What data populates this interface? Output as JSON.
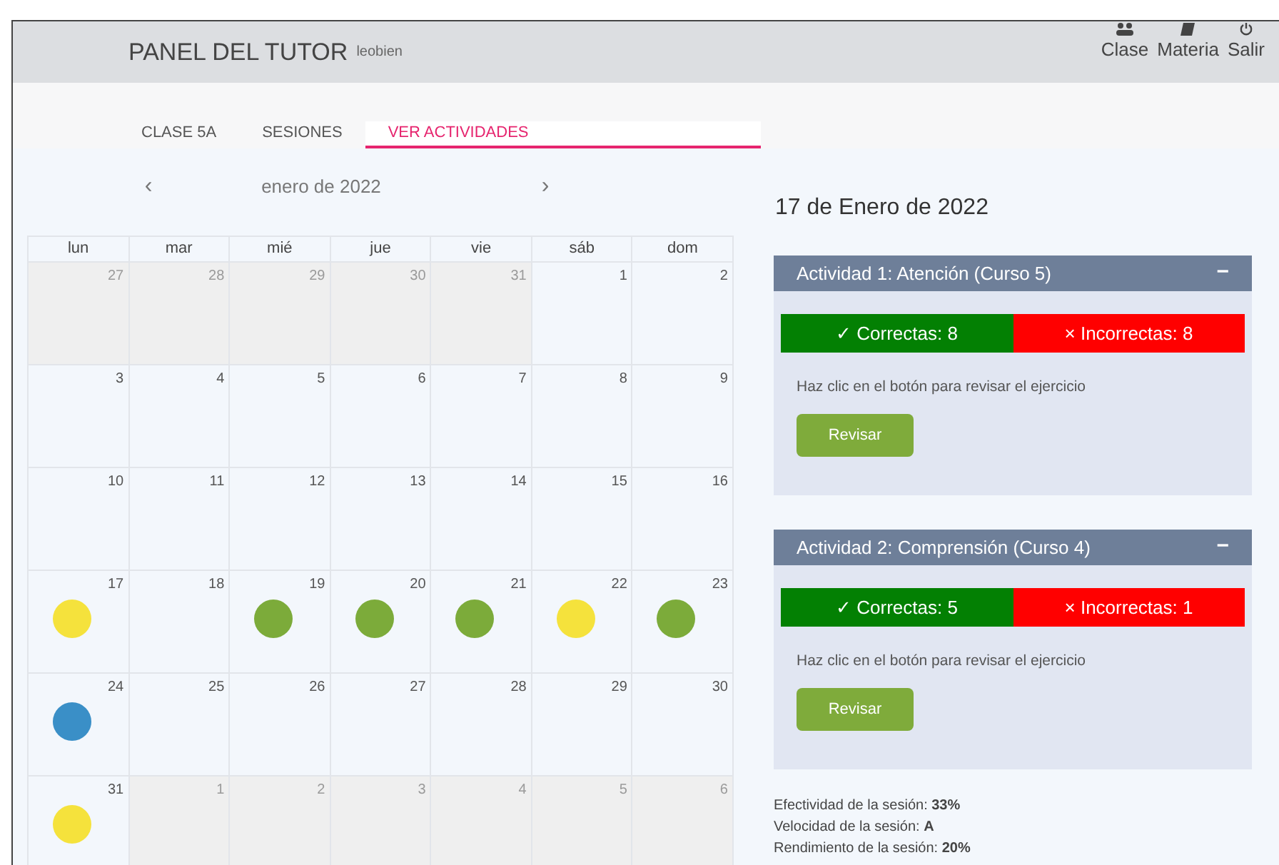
{
  "header": {
    "title": "PANEL DEL TUTOR",
    "user": "leobien",
    "nav": [
      {
        "label": "Clase"
      },
      {
        "label": "Materia"
      },
      {
        "label": "Salir"
      }
    ]
  },
  "tabs": [
    {
      "label": "CLASE 5A",
      "selected": false
    },
    {
      "label": "SESIONES",
      "selected": false
    },
    {
      "label": "VER ACTIVIDADES",
      "selected": true
    }
  ],
  "calendar": {
    "prev": "‹",
    "month": "enero de 2022",
    "next": "›",
    "weekdays": [
      "lun",
      "mar",
      "mié",
      "jue",
      "vie",
      "sáb",
      "dom"
    ],
    "weeks": [
      [
        {
          "day": "27",
          "outside": true
        },
        {
          "day": "28",
          "outside": true
        },
        {
          "day": "29",
          "outside": true
        },
        {
          "day": "30",
          "outside": true
        },
        {
          "day": "31",
          "outside": true
        },
        {
          "day": "1",
          "outside": false
        },
        {
          "day": "2",
          "outside": false
        }
      ],
      [
        {
          "day": "3",
          "outside": false
        },
        {
          "day": "4",
          "outside": false
        },
        {
          "day": "5",
          "outside": false
        },
        {
          "day": "6",
          "outside": false
        },
        {
          "day": "7",
          "outside": false
        },
        {
          "day": "8",
          "outside": false
        },
        {
          "day": "9",
          "outside": false
        }
      ],
      [
        {
          "day": "10",
          "outside": false
        },
        {
          "day": "11",
          "outside": false
        },
        {
          "day": "12",
          "outside": false
        },
        {
          "day": "13",
          "outside": false
        },
        {
          "day": "14",
          "outside": false
        },
        {
          "day": "15",
          "outside": false
        },
        {
          "day": "16",
          "outside": false
        }
      ],
      [
        {
          "day": "17",
          "outside": false,
          "color": "#f5e23c"
        },
        {
          "day": "18",
          "outside": false
        },
        {
          "day": "19",
          "outside": false,
          "color": "#7cab3a"
        },
        {
          "day": "20",
          "outside": false,
          "color": "#7cab3a"
        },
        {
          "day": "21",
          "outside": false,
          "color": "#7cab3a"
        },
        {
          "day": "22",
          "outside": false,
          "color": "#f5e23c"
        },
        {
          "day": "23",
          "outside": false,
          "color": "#7cab3a"
        }
      ],
      [
        {
          "day": "24",
          "outside": false,
          "color": "#3a8fc7"
        },
        {
          "day": "25",
          "outside": false
        },
        {
          "day": "26",
          "outside": false
        },
        {
          "day": "27",
          "outside": false
        },
        {
          "day": "28",
          "outside": false
        },
        {
          "day": "29",
          "outside": false
        },
        {
          "day": "30",
          "outside": false
        }
      ],
      [
        {
          "day": "31",
          "outside": false,
          "color": "#f5e23c"
        },
        {
          "day": "1",
          "outside": true
        },
        {
          "day": "2",
          "outside": true
        },
        {
          "day": "3",
          "outside": true
        },
        {
          "day": "4",
          "outside": true
        },
        {
          "day": "5",
          "outside": true
        },
        {
          "day": "6",
          "outside": true
        }
      ]
    ]
  },
  "detail": {
    "date": "17 de Enero de 2022",
    "activities": [
      {
        "title": "Actividad 1: Atención (Curso 5)",
        "toggle": "−",
        "expanded": true,
        "correct": "✓ Correctas: 8",
        "incorrect": "× Incorrectas: 8",
        "hint": "Haz clic en el botón para revisar el ejercicio",
        "button": "Revisar"
      },
      {
        "title": "Actividad 2: Comprensión (Curso 4)",
        "toggle": "−",
        "expanded": true,
        "correct": "✓ Correctas: 5",
        "incorrect": "× Incorrectas: 1",
        "hint": "Haz clic en el botón para revisar el ejercicio",
        "button": "Revisar"
      }
    ],
    "stats": [
      "Efectividad de la sesión: **33%**",
      "Velocidad de la sesión: **A**",
      "Rendimiento de la sesión: **20%**"
    ]
  }
}
